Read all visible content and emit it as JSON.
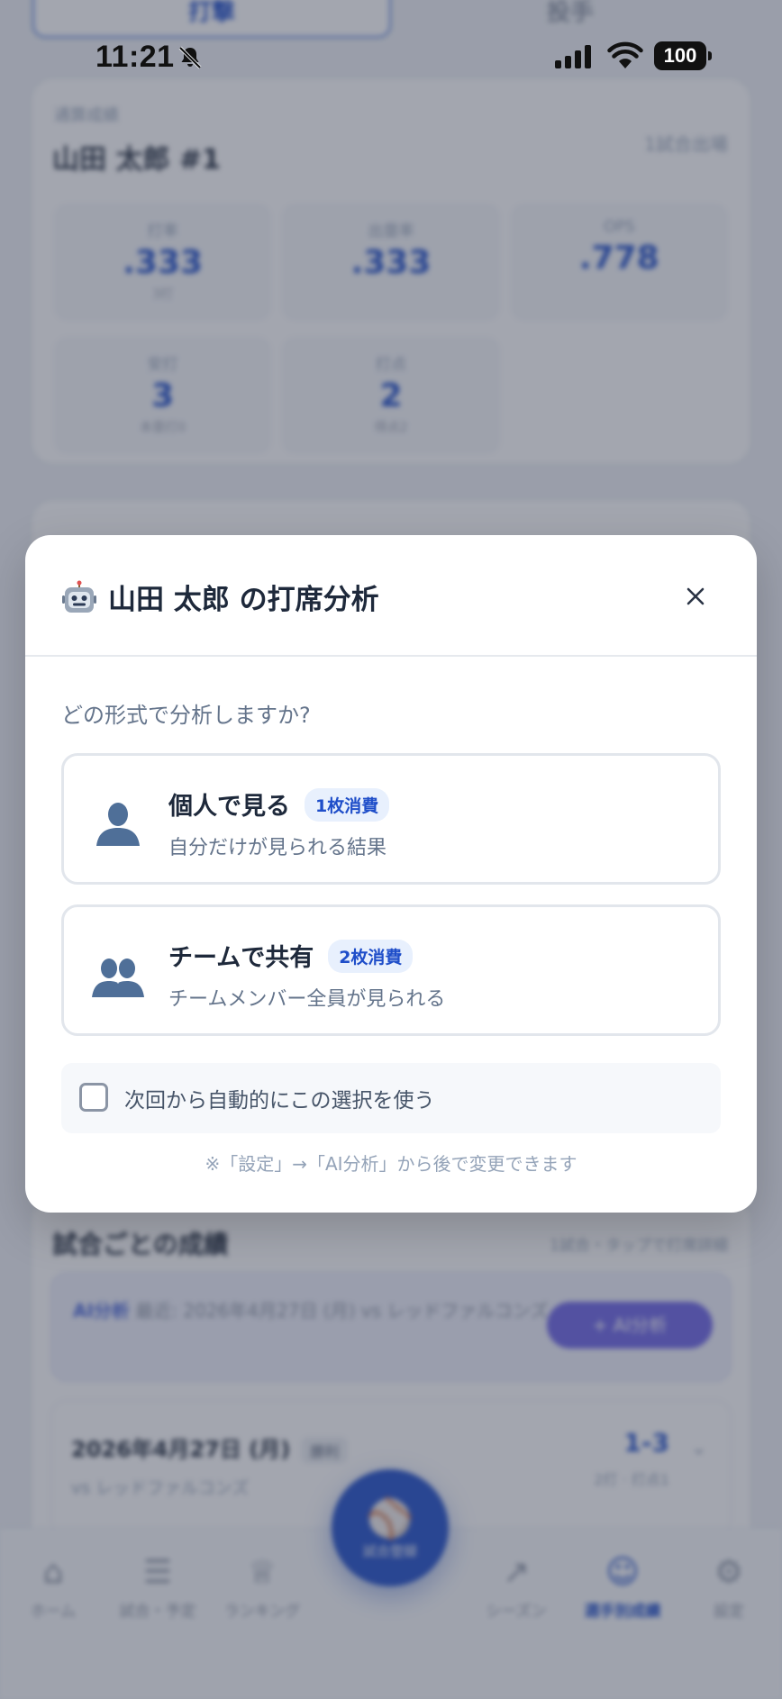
{
  "status_bar": {
    "time": "11:21",
    "battery": "100"
  },
  "background": {
    "top_tabs": [
      "打撃",
      "投手"
    ],
    "stats_card": {
      "subtitle": "通算成績",
      "player": "山田 太郎 #1",
      "games": "1試合出場",
      "cells": [
        {
          "label": "打率",
          "value": ".333",
          "note": "3打"
        },
        {
          "label": "出塁率",
          "value": ".333",
          "note": ""
        },
        {
          "label": "OPS",
          "value": ".778",
          "note": ""
        },
        {
          "label": "安打",
          "value": "3",
          "note": "本塁打0"
        },
        {
          "label": "打点",
          "value": "2",
          "note": "得点2"
        }
      ]
    },
    "games_card": {
      "title": "試合ごとの成績",
      "hint": "1試合・タップで打席詳細",
      "ai_banner": {
        "prefix": "AI分析",
        "text": "最近: 2026年4月27日 (月) vs レッドファルコンズ",
        "button": "+ AI分析"
      },
      "game": {
        "date": "2026年4月27日 (月)",
        "tag": "勝利",
        "opponent": "vs レッドファルコンズ",
        "score": "1-3",
        "detail": "2打 · 打点1"
      }
    },
    "tabbar": {
      "items": [
        "ホーム",
        "試合・予定",
        "ランキング",
        "シーズン",
        "選手別成績",
        "設定"
      ],
      "fab": "試合登録"
    }
  },
  "modal": {
    "title": "山田 太郎 の打席分析",
    "question": "どの形式で分析しますか?",
    "options": [
      {
        "title": "個人で見る",
        "badge": "1枚消費",
        "desc": "自分だけが見られる結果",
        "icon": "person-icon"
      },
      {
        "title": "チームで共有",
        "badge": "2枚消費",
        "desc": "チームメンバー全員が見られる",
        "icon": "people-icon"
      }
    ],
    "remember_label": "次回から自動的にこの選択を使う",
    "footnote": "※「設定」→「AI分析」から後で変更できます"
  },
  "colors": {
    "accent": "#1f4ec9",
    "badge_bg": "#e8f0fd",
    "icon_blue": "#4f6f98"
  }
}
